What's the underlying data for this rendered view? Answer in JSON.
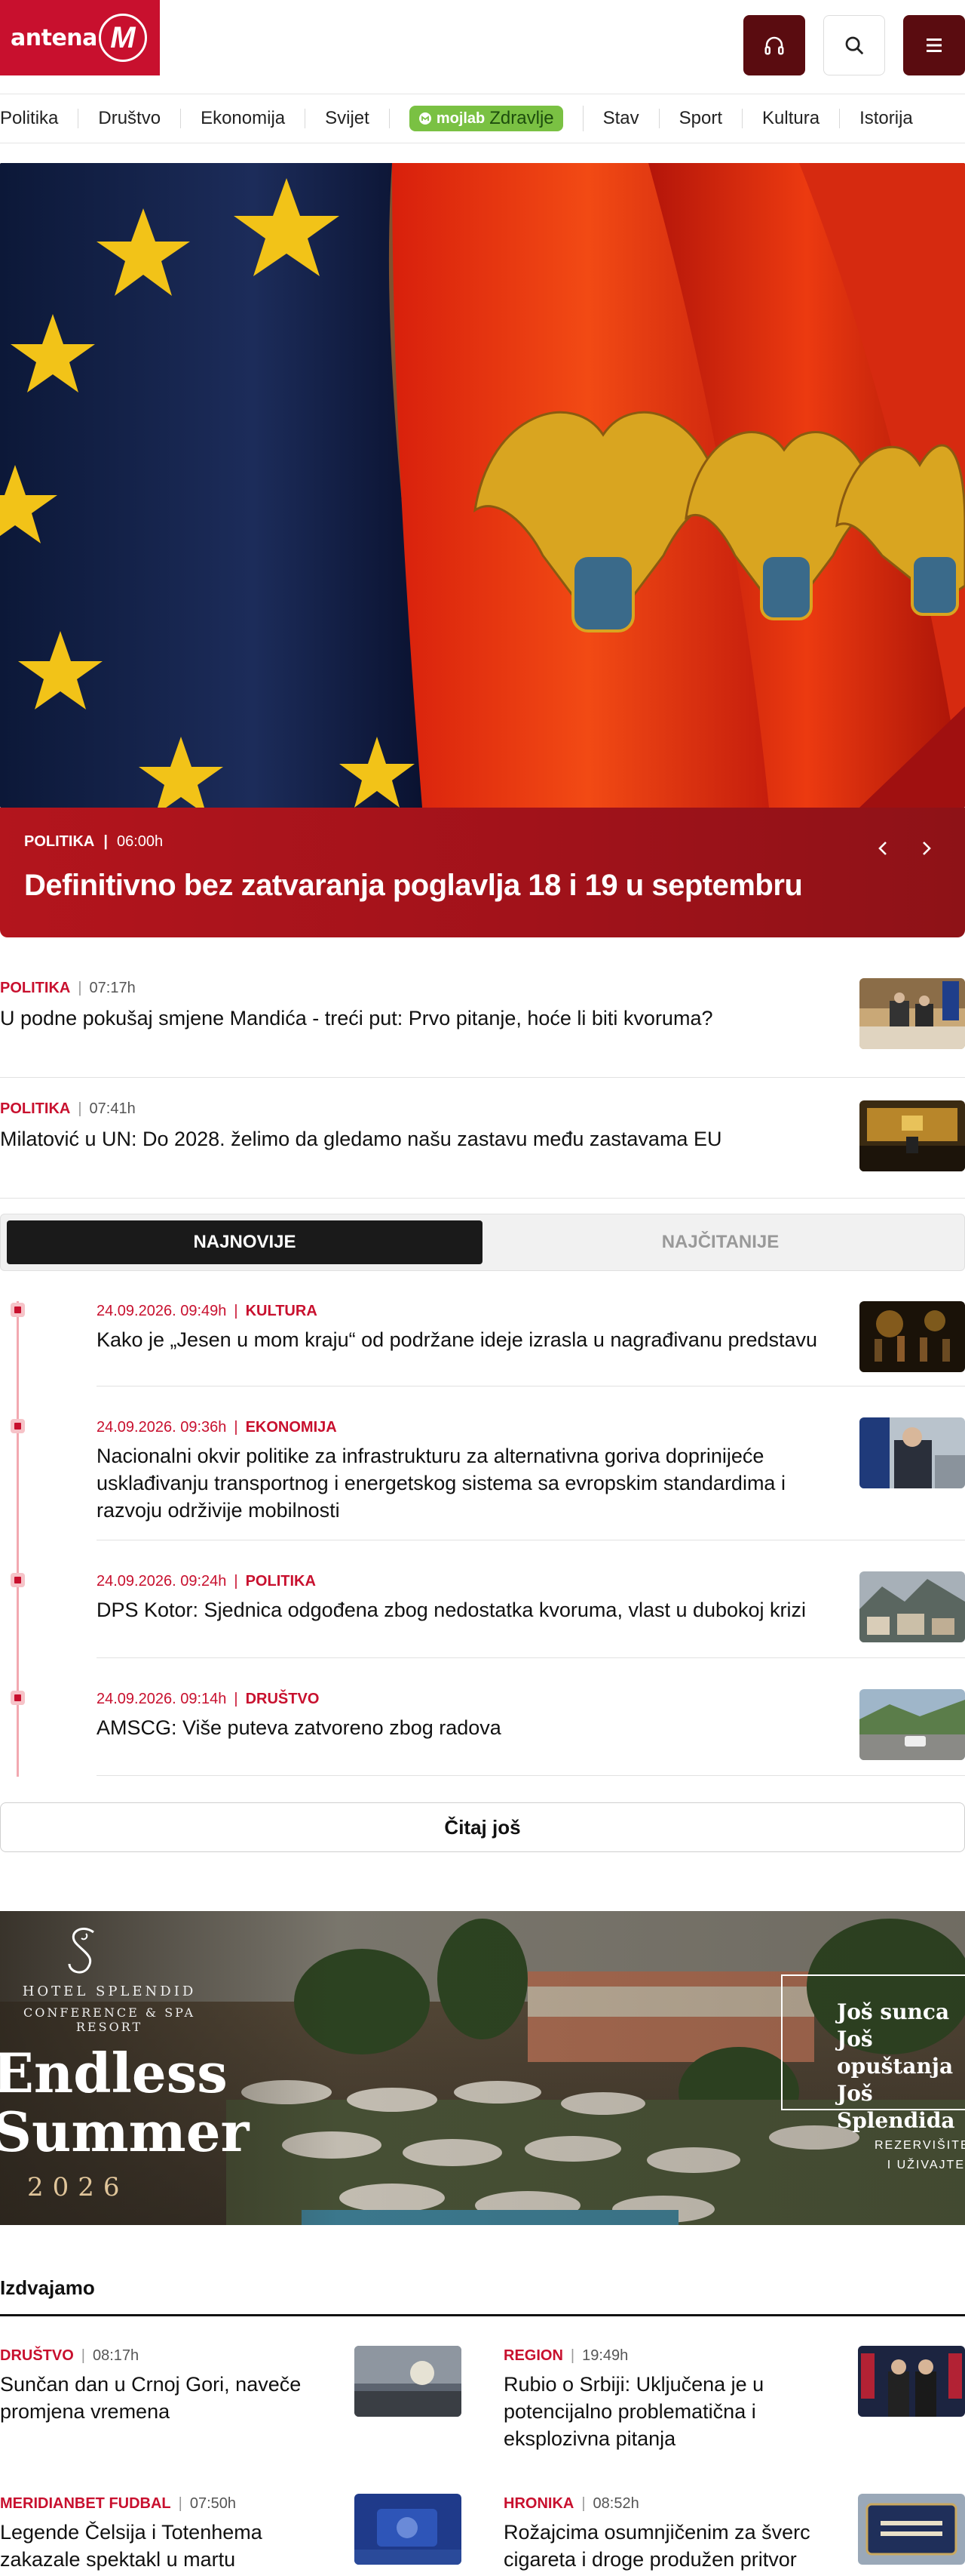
{
  "header": {
    "logo_text": "antena",
    "logo_mark": "M",
    "buttons": {
      "audio_icon": "headphones-icon",
      "search_icon": "search-icon",
      "menu_icon": "hamburger-menu-icon"
    }
  },
  "nav": {
    "items": [
      "Politika",
      "Društvo",
      "Ekonomija",
      "Svijet"
    ],
    "pill": {
      "prefix": "mojlab",
      "label": "Zdravlje"
    },
    "items_after": [
      "Stav",
      "Sport",
      "Kultura",
      "Istorija"
    ]
  },
  "hero": {
    "slides_count": 6,
    "active_slide": 1,
    "category": "POLITIKA",
    "time": "06:00h",
    "title": "Definitivno bez zatvaranja poglavlja 18 i 19 u septembru"
  },
  "stories": [
    {
      "category": "POLITIKA",
      "time": "07:17h",
      "title": "U podne pokušaj smjene Mandića - treći put: Prvo pitanje, hoće li biti kvoruma?"
    },
    {
      "category": "POLITIKA",
      "time": "07:41h",
      "title": "Milatović u UN: Do 2028. želimo da gledamo našu zastavu među zastavama EU"
    }
  ],
  "tabs": {
    "latest": "NAJNOVIJE",
    "most_read": "NAJČITANIJE"
  },
  "timeline": [
    {
      "datetime": "24.09.2026. 09:49h",
      "category": "KULTURA",
      "title": "Kako je „Jesen u mom kraju“ od podržane ideje izrasla u nagrađivanu predstavu"
    },
    {
      "datetime": "24.09.2026. 09:36h",
      "category": "EKONOMIJA",
      "title": "Nacionalni okvir politike za infrastrukturu za alternativna goriva doprinijeće usklađivanju transportnog i energetskog sistema sa evropskim standardima i razvoju održivije mobilnosti"
    },
    {
      "datetime": "24.09.2026. 09:24h",
      "category": "POLITIKA",
      "title": "DPS Kotor: Sjednica odgođena zbog nedostatka kvoruma, vlast u dubokoj krizi"
    },
    {
      "datetime": "24.09.2026. 09:14h",
      "category": "DRUŠTVO",
      "title": "AMSCG: Više puteva zatvoreno zbog radova"
    }
  ],
  "more_button": "Čitaj još",
  "ad": {
    "brand_line1": "HOTEL SPLENDID",
    "brand_line2": "CONFERENCE & SPA RESORT",
    "headline_1": "Endless",
    "headline_2": "Summer",
    "year": "2026",
    "box_1": "Još sunca",
    "box_2": "Još opuštanja",
    "box_3": "Još Splendida",
    "reserve_1": "REZERVIŠITE",
    "reserve_2": "I UŽIVAJTE"
  },
  "featured": {
    "title": "Izdvajamo",
    "cards": [
      {
        "category": "DRUŠTVO",
        "time": "08:17h",
        "title": "Sunčan dan u Crnoj Gori, naveče promjena vremena"
      },
      {
        "category": "REGION",
        "time": "19:49h",
        "title": "Rubio o Srbiji: Uključena je u potencijalno problematična i eksplozivna pitanja"
      },
      {
        "category": "MERIDIANBET FUDBAL",
        "time": "07:50h",
        "title": "Legende Čelsija i Totenhema zakazale spektakl u martu"
      },
      {
        "category": "HRONIKA",
        "time": "08:52h",
        "title": "Rožajcima osumnjičenim za šverc cigareta i droge produžen pritvor"
      }
    ]
  }
}
